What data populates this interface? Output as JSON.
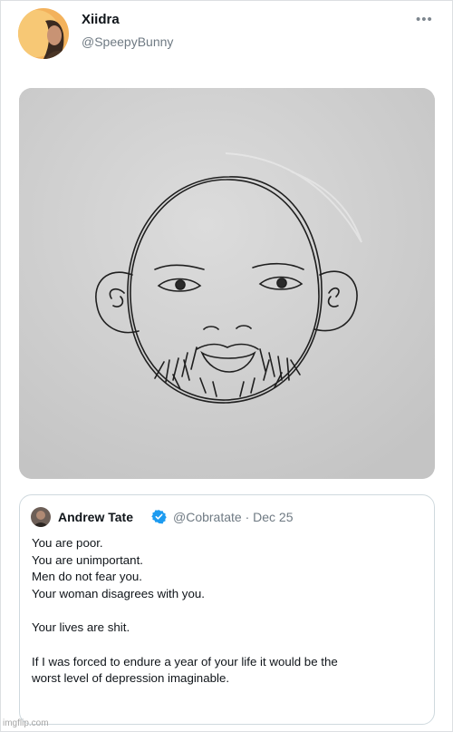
{
  "tweet": {
    "author_name": "Xiidra",
    "author_handle": "@SpeepyBunny",
    "more_icon": "more-icon",
    "media_description": "pencil-sketch-portrait"
  },
  "quoted_tweet": {
    "author_name": "Andrew Tate",
    "verified_icon": "verified-badge-icon",
    "handle_and_date": "@Cobratate · Dec 25",
    "lines": [
      "You are poor.",
      "You are unimportant.",
      "Men do not fear you.",
      "Your woman disagrees with you.",
      "",
      "Your lives are shit.",
      "",
      "If I was forced to endure a year of your life it would be the",
      "worst level of depression imaginable."
    ]
  },
  "watermark": "imgflip.com",
  "colors": {
    "verified_blue": "#1d9bf0",
    "secondary_text": "#6f7a83",
    "border": "#cfd9de"
  }
}
